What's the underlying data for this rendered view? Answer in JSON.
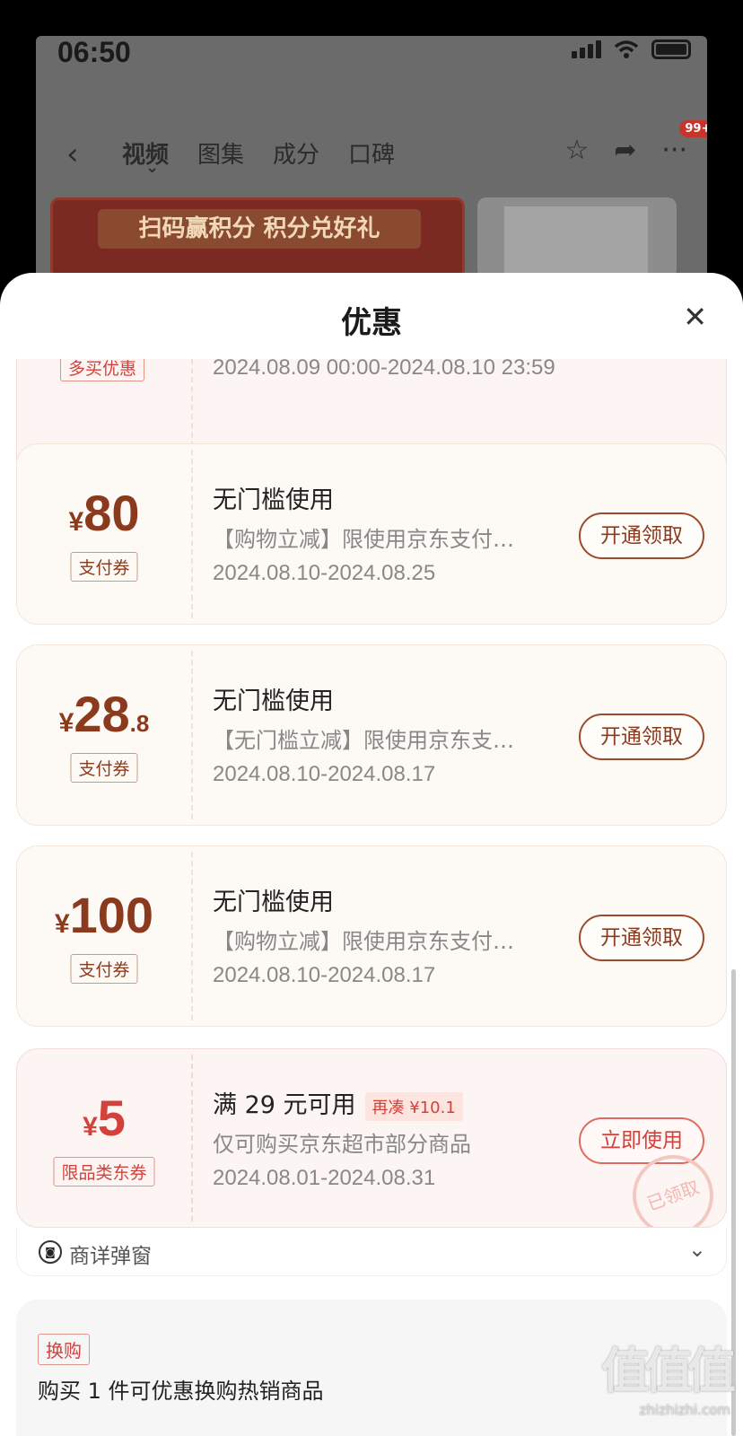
{
  "status_bar": {
    "time": "06:50"
  },
  "nav": {
    "tabs": [
      "视频",
      "图集",
      "成分",
      "口碑"
    ],
    "badge": "99+"
  },
  "banner": {
    "text": "扫码赢积分 积分兑好礼"
  },
  "sheet": {
    "title": "优惠"
  },
  "partial_coupon": {
    "tag": "多买优惠",
    "date": "2024.08.09 00:00-2024.08.10 23:59"
  },
  "coupons": [
    {
      "currency": "¥",
      "amount": "80",
      "decimal": "",
      "type": "支付券",
      "title": "无门槛使用",
      "desc": "【购物立减】限使用京东支付…",
      "date": "2024.08.10-2024.08.25",
      "button": "开通领取"
    },
    {
      "currency": "¥",
      "amount": "28",
      "decimal": ".8",
      "type": "支付券",
      "title": "无门槛使用",
      "desc": "【无门槛立减】限使用京东支…",
      "date": "2024.08.10-2024.08.17",
      "button": "开通领取"
    },
    {
      "currency": "¥",
      "amount": "100",
      "decimal": "",
      "type": "支付券",
      "title": "无门槛使用",
      "desc": "【购物立减】限使用京东支付…",
      "date": "2024.08.10-2024.08.17",
      "button": "开通领取"
    },
    {
      "currency": "¥",
      "amount": "5",
      "decimal": "",
      "type": "限品类东券",
      "title": "满 29 元可用",
      "extra": "再凑 ¥10.1",
      "desc": "仅可购买京东超市部分商品",
      "date": "2024.08.01-2024.08.31",
      "button": "立即使用",
      "stamp": "已领取"
    }
  ],
  "source": {
    "label": "商详弹窗"
  },
  "swap": {
    "tag": "换购",
    "text": "购买 1 件可优惠换购热销商品"
  },
  "watermark": {
    "logo": "值值值",
    "url": "zhizhizhi.com"
  }
}
